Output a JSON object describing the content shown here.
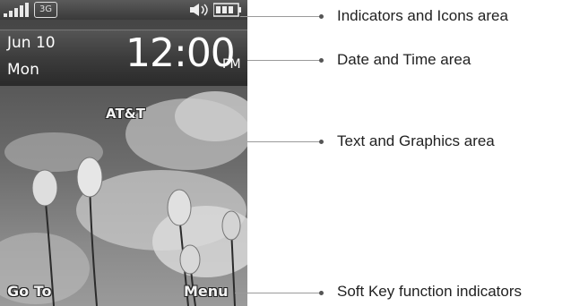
{
  "phone": {
    "status": {
      "network_badge": "3G",
      "icons": [
        "signal-strength-icon",
        "network-3g-icon",
        "speaker-volume-icon",
        "battery-icon"
      ]
    },
    "date_line1": "Jun 10",
    "date_line2": "Mon",
    "time": "12:00",
    "ampm": "PM",
    "carrier": "AT&T",
    "softkey_left": "Go To",
    "softkey_right": "Menu"
  },
  "callouts": [
    {
      "label": "Indicators and Icons area"
    },
    {
      "label": "Date and Time area"
    },
    {
      "label": "Text and Graphics area"
    },
    {
      "label": "Soft Key function indicators"
    }
  ]
}
